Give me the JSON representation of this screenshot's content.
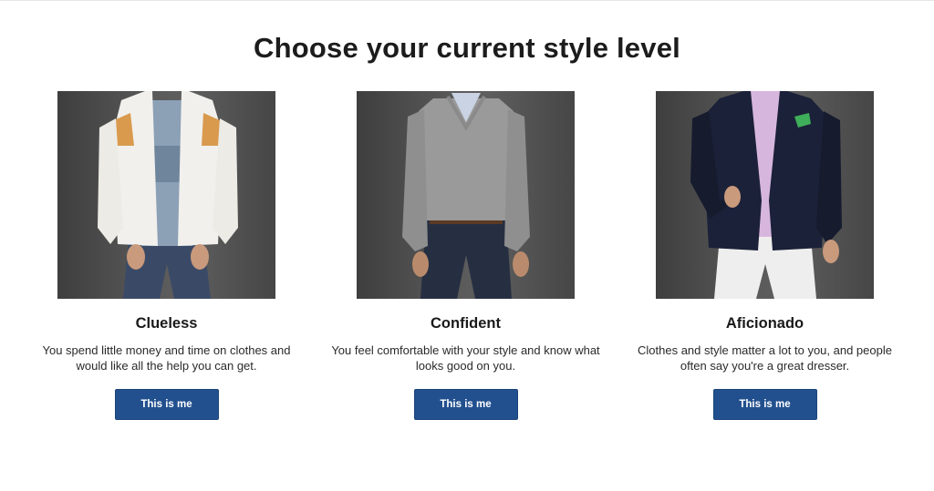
{
  "page": {
    "title": "Choose your current style level"
  },
  "levels": [
    {
      "name": "Clueless",
      "description": "You spend little money and time on clothes and would like all the help you can get.",
      "button_label": "This is me",
      "photo": "man-in-white-track-jacket-and-jeans"
    },
    {
      "name": "Confident",
      "description": "You feel comfortable with your style and know what looks good on you.",
      "button_label": "This is me",
      "photo": "man-in-grey-v-neck-sweater-and-jeans"
    },
    {
      "name": "Aficionado",
      "description": "Clothes and style matter a lot to you, and people often say you're a great dresser.",
      "button_label": "This is me",
      "photo": "man-in-navy-blazer-and-white-trousers"
    }
  ],
  "colors": {
    "button_bg": "#22508f",
    "button_text": "#ffffff",
    "title_text": "#1c1c1c",
    "photo_bg": "#555555"
  }
}
